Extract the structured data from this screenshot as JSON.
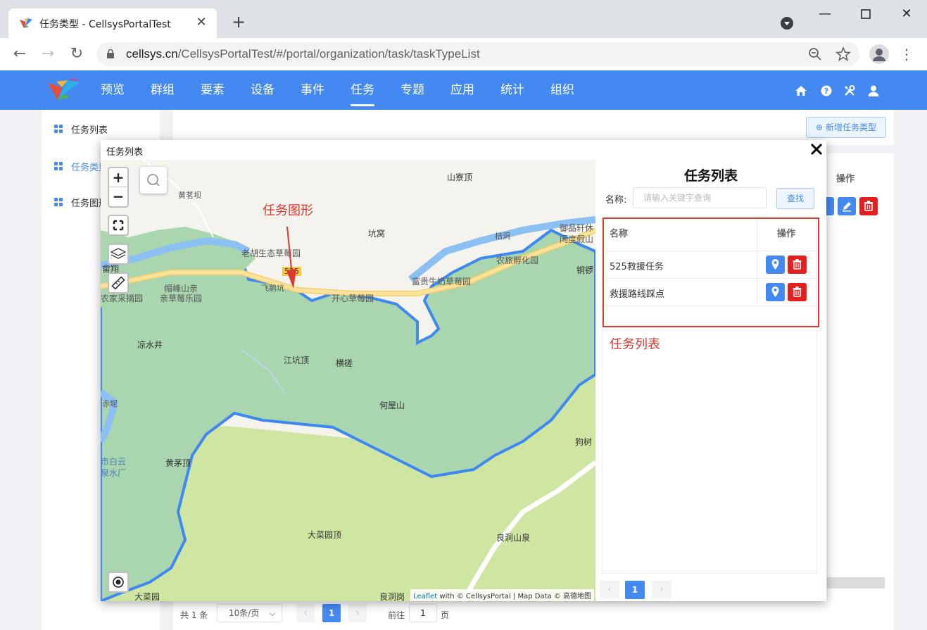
{
  "browser": {
    "tab_title": "任务类型 - CellsysPortalTest",
    "url_host": "cellsys.cn",
    "url_path": "/CellsysPortalTest/#/portal/organization/task/taskTypeList"
  },
  "app": {
    "menu": [
      "预览",
      "群组",
      "要素",
      "设备",
      "事件",
      "任务",
      "专题",
      "应用",
      "统计",
      "组织"
    ],
    "active_menu": "任务",
    "accent": "#4489f2"
  },
  "sidebar": {
    "items": [
      {
        "label": "任务列表"
      },
      {
        "label": "任务类型"
      },
      {
        "label": "任务图形"
      }
    ]
  },
  "main": {
    "add_button": "新增任务类型",
    "op_header": "操作",
    "pagination": {
      "total": "共 1 条",
      "page_size": "10条/页",
      "prev": "‹",
      "current": "1",
      "next": "›",
      "goto_label": "前往",
      "goto_value": "1",
      "page_suffix": "页"
    }
  },
  "modal": {
    "title": "任务列表",
    "map": {
      "attribution_link": "Leaflet",
      "attribution_text": " with © CellsysPortal | Map Data © 高德地图",
      "labels": [
        "山寮顶",
        "黄茗坝",
        "坑窝",
        "桔洞",
        "老胡生态草莓园",
        "525",
        "御品轩休",
        "闲度假山",
        "畲翔",
        "飞鹅坑",
        "开心草莓园",
        "富贵牛奶草莓园",
        "农旅孵化园",
        "铜锣",
        "帽峰山亲",
        "亲草莓乐园",
        "农家采摘园",
        "凉水井",
        "江坑顶",
        "横槎",
        "何屋山",
        "赤坭",
        "黄茅顶",
        "狗树",
        "市白云",
        "泉水厂",
        "大菜园顶",
        "良洞山泉",
        "大菜园",
        "良洞岗"
      ]
    },
    "annotations": {
      "shape": "任务图形",
      "list": "任务列表"
    },
    "panel": {
      "title": "任务列表",
      "name_label": "名称:",
      "search_placeholder": "请输入关键字查询",
      "search_button": "查找",
      "col_name": "名称",
      "col_op": "操作",
      "rows": [
        {
          "name": "525救援任务"
        },
        {
          "name": "救援路线踩点"
        }
      ],
      "pager": {
        "prev": "‹",
        "current": "1",
        "next": "›"
      }
    }
  }
}
